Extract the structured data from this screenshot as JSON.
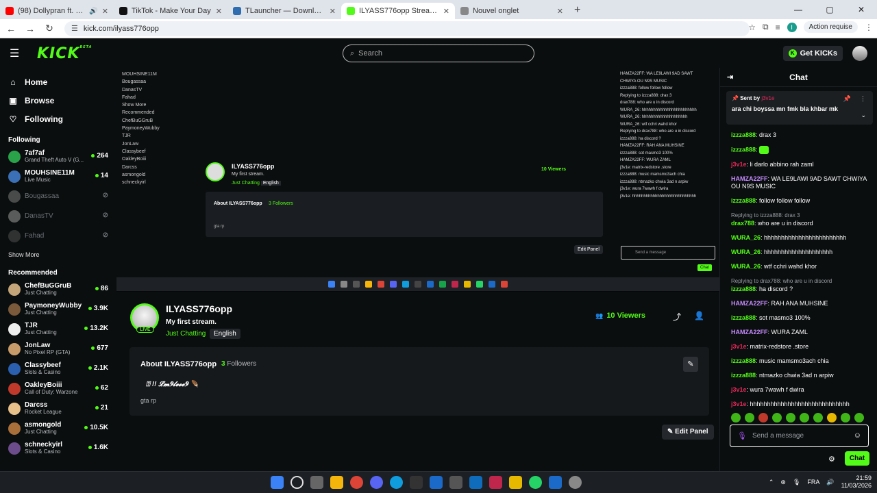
{
  "browser": {
    "tabs": [
      {
        "title": "(98) Dollypran ft. ElGrande",
        "color": "#ff0000"
      },
      {
        "title": "TikTok - Make Your Day",
        "color": "#111111"
      },
      {
        "title": "TLauncher — Download Minec",
        "color": "#2f6db0"
      },
      {
        "title": "ILYASS776opp Stream - Watch L",
        "color": "#53fc18"
      },
      {
        "title": "Nouvel onglet",
        "color": "#888888"
      }
    ],
    "url": "kick.com/ilyass776opp",
    "action_required": "Action requise",
    "profile_initial": "I"
  },
  "header": {
    "logo": "KICK",
    "logo_beta": "BETA",
    "search_placeholder": "Search",
    "get_kicks": "Get KICKs"
  },
  "sidebar": {
    "nav": [
      {
        "label": "Home",
        "icon": "home-icon",
        "glyph": "⌂"
      },
      {
        "label": "Browse",
        "icon": "browse-icon",
        "glyph": "▣"
      },
      {
        "label": "Following",
        "icon": "heart-icon",
        "glyph": "♡"
      }
    ],
    "following_title": "Following",
    "following": [
      {
        "name": "7af7af",
        "category": "Grand Theft Auto V (G...",
        "viewers": "264",
        "online": true,
        "color": "#2aa24a"
      },
      {
        "name": "MOUHSINE11M",
        "category": "Live Music",
        "viewers": "14",
        "online": true,
        "color": "#3b6fb6"
      },
      {
        "name": "Bougassaa",
        "category": "",
        "viewers": "",
        "online": false,
        "color": "#888"
      },
      {
        "name": "DanasTV",
        "category": "",
        "viewers": "",
        "online": false,
        "color": "#aaa"
      },
      {
        "name": "Fahad",
        "category": "",
        "viewers": "",
        "online": false,
        "color": "#555"
      }
    ],
    "show_more": "Show More",
    "recommended_title": "Recommended",
    "recommended": [
      {
        "name": "ChefBuGGruB",
        "category": "Just Chatting",
        "viewers": "86",
        "color": "#c4a57a"
      },
      {
        "name": "PaymoneyWubby",
        "category": "Just Chatting",
        "viewers": "3.9K",
        "color": "#7a5a3a"
      },
      {
        "name": "TJR",
        "category": "Just Chatting",
        "viewers": "13.2K",
        "color": "#eeeeee"
      },
      {
        "name": "JonLaw",
        "category": "No Pixel RP (GTA)",
        "viewers": "677",
        "color": "#c89b6a"
      },
      {
        "name": "Classybeef",
        "category": "Slots & Casino",
        "viewers": "2.1K",
        "color": "#2b5fb0"
      },
      {
        "name": "OakleyBoiii",
        "category": "Call of Duty: Warzone",
        "viewers": "62",
        "color": "#c0392b"
      },
      {
        "name": "Darcss",
        "category": "Rocket League",
        "viewers": "21",
        "color": "#e8c08a"
      },
      {
        "name": "asmongold",
        "category": "Just Chatting",
        "viewers": "10.5K",
        "color": "#a86f3b"
      },
      {
        "name": "schneckyirl",
        "category": "Slots & Casino",
        "viewers": "1.6K",
        "color": "#6d4c8c"
      }
    ]
  },
  "channel": {
    "name": "ILYASS776opp",
    "live_label": "LIVE",
    "title": "My first stream.",
    "category": "Just Chatting",
    "language": "English",
    "viewers": "10 Viewers",
    "about_title": "About ILYASS776opp",
    "followers_count": "3",
    "followers_label": "Followers",
    "bio": "⍰ !! 𝓛𝓶𝟗𝓵𝓮𝓮𝓮𝟗 🪶",
    "bio2": "gta rp",
    "edit_panel": "Edit Panel"
  },
  "chat": {
    "title": "Chat",
    "pinned_by_label": "Sent by",
    "pinned_by": "j3v1e",
    "pinned_message": "ara chi boyssa mn fmk bla khbar mk",
    "messages": [
      {
        "user": "izzza888",
        "color": "#53fc18",
        "text": "drax 3"
      },
      {
        "user": "izzza888",
        "color": "#53fc18",
        "text": "",
        "emote": true
      },
      {
        "user": "j3v1e",
        "color": "#e6295b",
        "text": "li darlo abbino rah zaml"
      },
      {
        "user": "HAMZA22FF",
        "color": "#c68cff",
        "text": "WA LE9LAWI 9AD SAWT CHWIYA OU N9S MUSIC"
      },
      {
        "user": "izzza888",
        "color": "#53fc18",
        "text": "follow follow follow"
      },
      {
        "reply": "Replying to izzza888: drax 3",
        "user": "drax788",
        "color": "#53fc18",
        "text": "who are u in discord"
      },
      {
        "user": "WURA_26",
        "color": "#53fc18",
        "text": "hhhhhhhhhhhhhhhhhhhhhhhh"
      },
      {
        "user": "WURA_26",
        "color": "#53fc18",
        "text": "hhhhhhhhhhhhhhhhhhhh"
      },
      {
        "user": "WURA_26",
        "color": "#53fc18",
        "text": "wtf cchri wahd khor"
      },
      {
        "reply": "Replying to drax788: who are u in discord",
        "user": "izzza888",
        "color": "#53fc18",
        "text": "ha discord ?"
      },
      {
        "user": "HAMZA22FF",
        "color": "#c68cff",
        "text": "RAH ANA MUHSINE"
      },
      {
        "user": "izzza888",
        "color": "#53fc18",
        "text": "sot masmo3 100%"
      },
      {
        "user": "HAMZA22FF",
        "color": "#c68cff",
        "text": "WURA ZAML"
      },
      {
        "user": "j3v1e",
        "color": "#e6295b",
        "text": "matrix-redstore .store"
      },
      {
        "user": "izzza888",
        "color": "#53fc18",
        "text": "music mamsmo3ach chia"
      },
      {
        "user": "izzza888",
        "color": "#53fc18",
        "text": "ntmazko chwia 3ad n arpiw"
      },
      {
        "user": "j3v1e",
        "color": "#e6295b",
        "text": "wura 7wawh f dwira"
      },
      {
        "user": "j3v1e",
        "color": "#e6295b",
        "text": "hhhhhhhhhhhhhhhhhhhhhhhhhhhhh"
      }
    ],
    "input_placeholder": "Send a message",
    "send_label": "Chat"
  },
  "taskbar": {
    "lang": "FRA",
    "time": "21:59",
    "date": "11/03/2026"
  },
  "stream_preview": {
    "channel": "ILYASS776opp",
    "title": "My first stream.",
    "category": "Just Chatting",
    "language": "English",
    "about": "About ILYASS776opp",
    "followers": "3 Followers",
    "bio2": "gta rp",
    "viewers": "10 Viewers",
    "edit_panel": "Edit Panel",
    "send": "Send a message",
    "chat_btn": "Chat",
    "chat_lines": [
      "HAMZA22FF: WA LE9LAWI 9AD SAWT",
      "CHWIYA OU N9S MUSIC",
      "izzza888: follow follow follow",
      "Replying to izzza888: drax 3",
      "drax788: who are u in discord",
      "WURA_26: hhhhhhhhhhhhhhhhhhhhhhhh",
      "WURA_26: hhhhhhhhhhhhhhhhhhhh",
      "WURA_26: wtf cchri wahd khor",
      "Replying to drax788: who are u in discord",
      "izzza888: ha discord ?",
      "HAMZA22FF: RAH ANA MUHSINE",
      "izzza888: sot masmo3 100%",
      "HAMZA22FF: WURA ZAML",
      "j3v1e: matrix-redstore .store",
      "izzza888: music mamsmo3ach chia",
      "izzza888: ntmazko chwia 3ad n arpiw",
      "j3v1e: wura 7wawh f dwira",
      "j3v1e: hhhhhhhhhhhhhhhhhhhhhhhhhhhh"
    ],
    "sidebar_lines": [
      "MOUHSINE11M",
      "Bougassaa",
      "DanasTV",
      "Fahad",
      "Show More",
      "Recommended",
      "ChefBuGGruB",
      "PaymoneyWubby",
      "TJR",
      "JonLaw",
      "Classybeef",
      "OakleyBoiii",
      "Darcss",
      "asmongold",
      "schneckyirl"
    ]
  }
}
